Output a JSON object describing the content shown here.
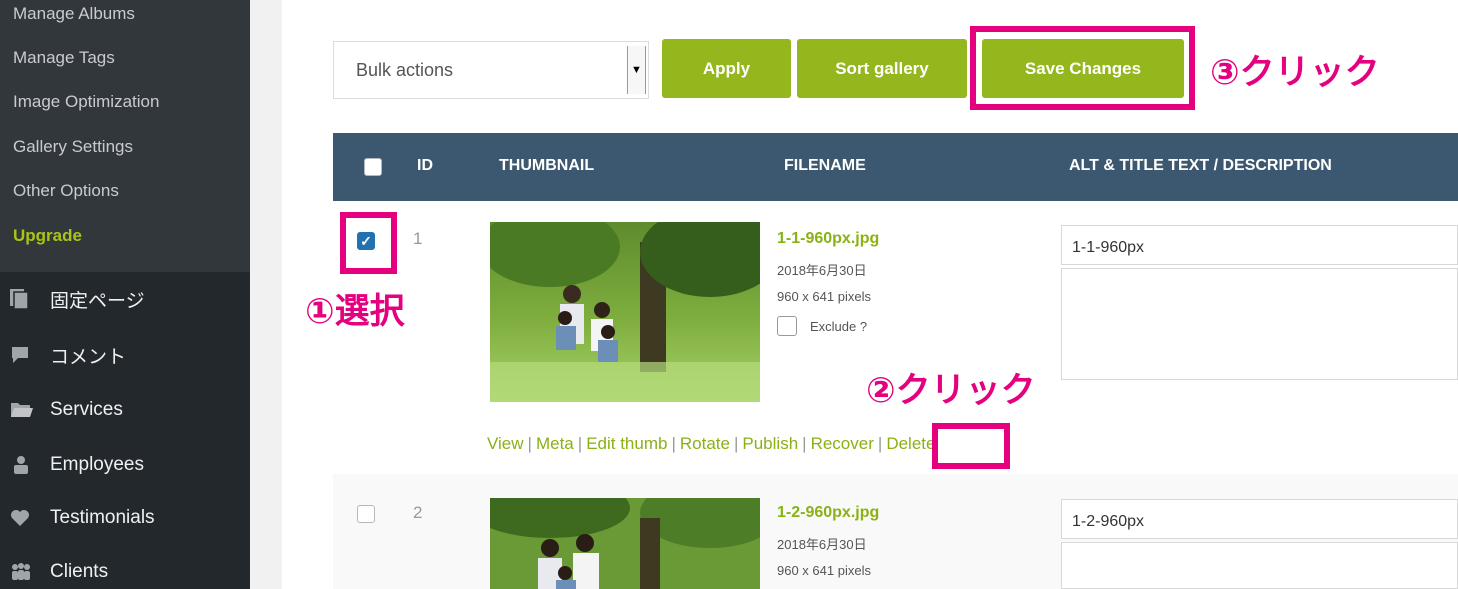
{
  "sidebar": {
    "submenu": [
      {
        "label": "Manage Albums"
      },
      {
        "label": "Manage Tags"
      },
      {
        "label": "Image Optimization"
      },
      {
        "label": "Gallery Settings"
      },
      {
        "label": "Other Options"
      },
      {
        "label": "Upgrade"
      }
    ],
    "menu": [
      {
        "label": "固定ページ",
        "icon": "page-icon"
      },
      {
        "label": "コメント",
        "icon": "comment-icon"
      },
      {
        "label": "Services",
        "icon": "folder-icon"
      },
      {
        "label": "Employees",
        "icon": "people-icon"
      },
      {
        "label": "Testimonials",
        "icon": "heart-icon"
      },
      {
        "label": "Clients",
        "icon": "group-icon"
      }
    ]
  },
  "toolbar": {
    "bulk_actions": "Bulk actions",
    "apply": "Apply",
    "sort_gallery": "Sort gallery",
    "save_changes": "Save Changes"
  },
  "table": {
    "headers": {
      "id": "ID",
      "thumbnail": "THUMBNAIL",
      "filename": "FILENAME",
      "alt_title": "ALT & TITLE TEXT / DESCRIPTION"
    },
    "rows": [
      {
        "id": "1",
        "checked": true,
        "filename": "1-1-960px.jpg",
        "date": "2018年6月30日",
        "size": "960 x 641 pixels",
        "exclude": "Exclude ?",
        "alt": "1-1-960px"
      },
      {
        "id": "2",
        "checked": false,
        "filename": "1-2-960px.jpg",
        "date": "2018年6月30日",
        "size": "960 x 641 pixels",
        "alt": "1-2-960px"
      }
    ],
    "row_actions": [
      "View",
      "Meta",
      "Edit thumb",
      "Rotate",
      "Publish",
      "Recover",
      "Delete"
    ]
  },
  "annotations": {
    "step1": "①選択",
    "step2": "②クリック",
    "step3": "③クリック"
  },
  "colors": {
    "accent_green": "#94b71d",
    "highlight_pink": "#e4007f",
    "header_blue": "#3c5870",
    "sidebar_dark": "#23282d"
  }
}
